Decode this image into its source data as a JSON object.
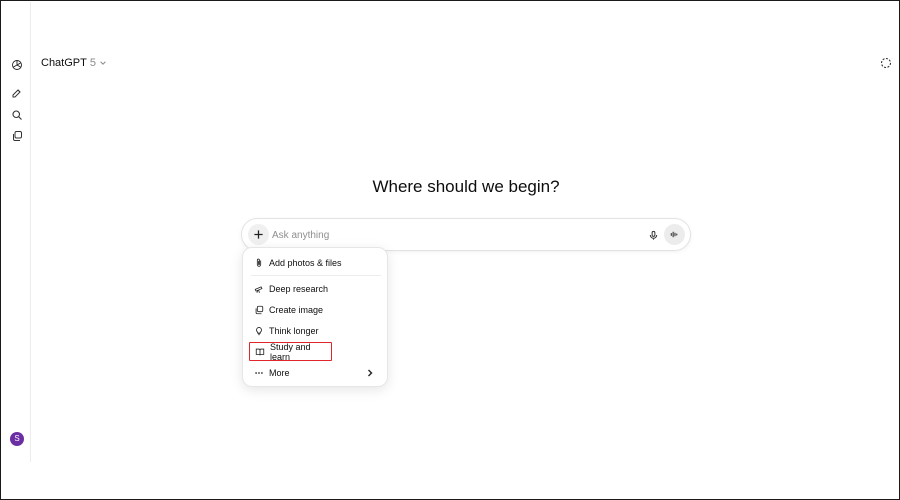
{
  "header": {
    "model_name": "ChatGPT",
    "model_version": "5"
  },
  "main": {
    "title": "Where should we begin?"
  },
  "composer": {
    "placeholder": "Ask anything"
  },
  "menu": {
    "items": [
      {
        "label": "Add photos & files",
        "icon": "paperclip-icon"
      },
      {
        "label": "Deep research",
        "icon": "telescope-icon"
      },
      {
        "label": "Create image",
        "icon": "image-icon"
      },
      {
        "label": "Think longer",
        "icon": "lightbulb-icon"
      },
      {
        "label": "Study and learn",
        "icon": "book-icon",
        "highlighted": true
      },
      {
        "label": "More",
        "icon": "more-dots-icon"
      }
    ]
  },
  "user": {
    "avatar_initial": "S",
    "avatar_color": "#6b2fa3"
  },
  "colors": {
    "highlight": "#e0262b"
  }
}
